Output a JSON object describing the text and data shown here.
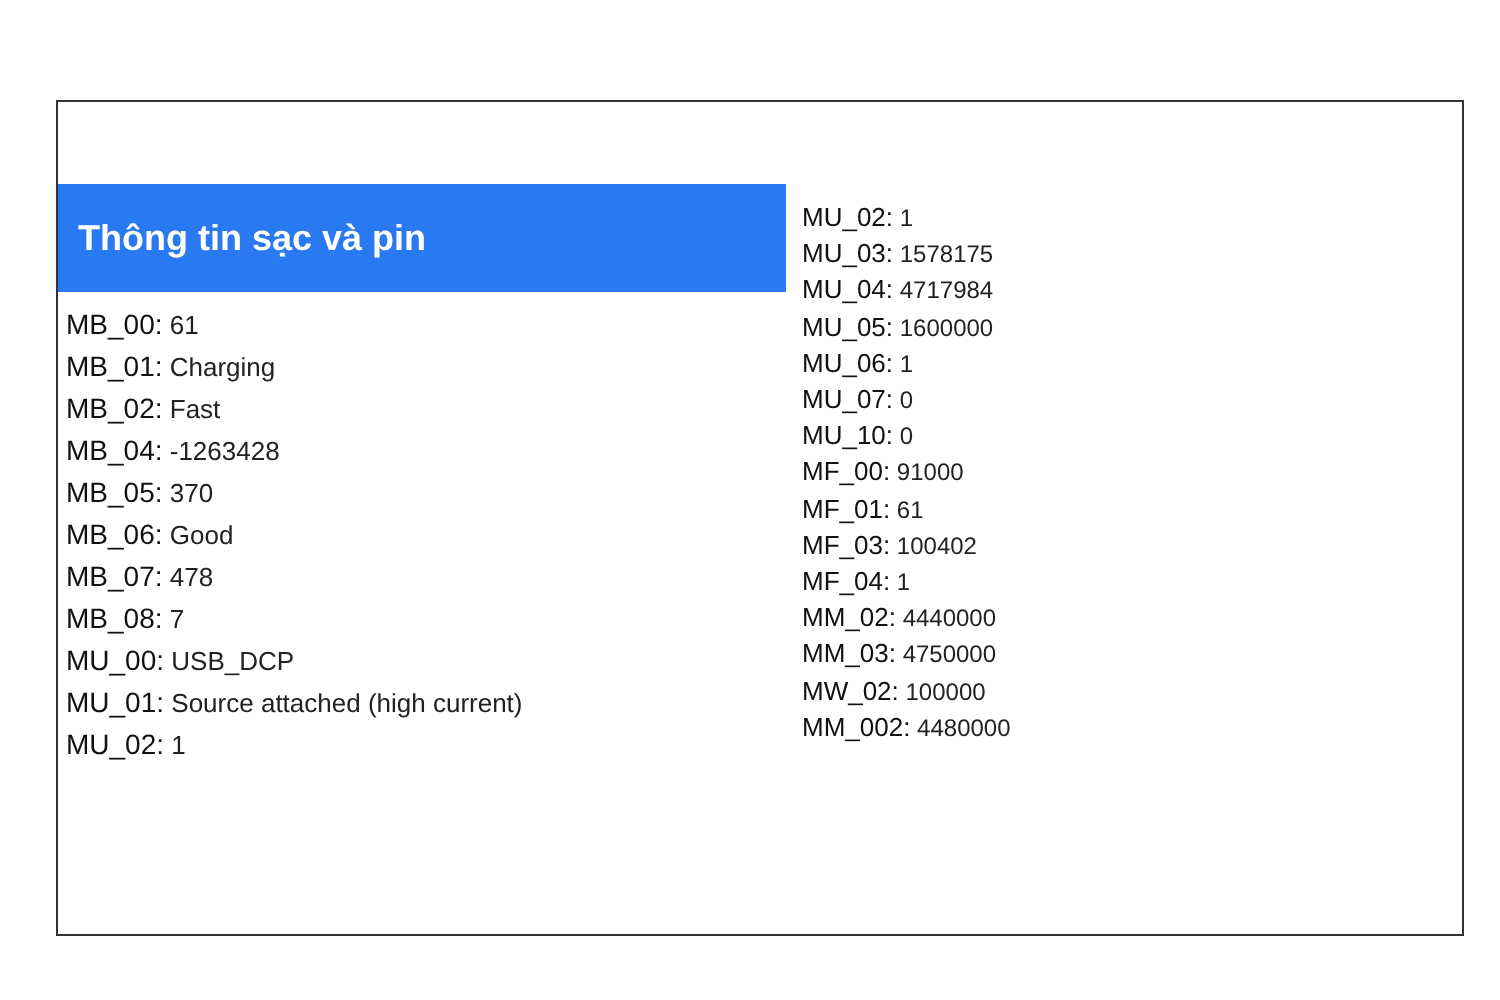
{
  "left_panel": {
    "title": "Thông tin sạc và pin",
    "rows": [
      {
        "key": "MB_00:",
        "value": "61"
      },
      {
        "key": "MB_01:",
        "value": "Charging"
      },
      {
        "key": "MB_02:",
        "value": "Fast"
      },
      {
        "key": "MB_04:",
        "value": "-1263428"
      },
      {
        "key": "MB_05:",
        "value": "370"
      },
      {
        "key": "MB_06:",
        "value": "Good"
      },
      {
        "key": "MB_07:",
        "value": "478"
      },
      {
        "key": "MB_08:",
        "value": "7"
      },
      {
        "key": "MU_00:",
        "value": "USB_DCP"
      },
      {
        "key": "MU_01:",
        "value": "Source attached (high current)"
      },
      {
        "key": "MU_02:",
        "value": "1"
      }
    ]
  },
  "right_panel": {
    "rows": [
      {
        "key": "MU_02:",
        "value": "1"
      },
      {
        "key": "MU_03:",
        "value": "1578175"
      },
      {
        "key": "MU_04:",
        "value": "4717984"
      },
      {
        "key": "MU_05:",
        "value": "1600000"
      },
      {
        "key": "MU_06:",
        "value": "1"
      },
      {
        "key": "MU_07:",
        "value": "0"
      },
      {
        "key": "MU_10:",
        "value": "0"
      },
      {
        "key": "MF_00:",
        "value": "91000"
      },
      {
        "key": "MF_01:",
        "value": "61"
      },
      {
        "key": "MF_03:",
        "value": "100402"
      },
      {
        "key": "MF_04:",
        "value": "1"
      },
      {
        "key": "MM_02:",
        "value": "4440000"
      },
      {
        "key": "MM_03:",
        "value": "4750000"
      },
      {
        "key": "MW_02:",
        "value": "100000"
      },
      {
        "key": "MM_002:",
        "value": "4480000"
      }
    ]
  }
}
